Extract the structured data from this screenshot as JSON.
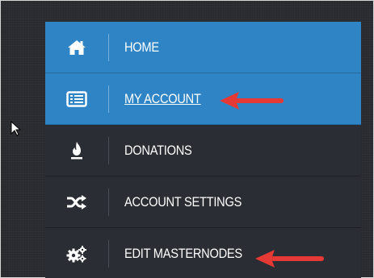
{
  "menu": {
    "items": [
      {
        "label": "HOME",
        "icon": "home-icon"
      },
      {
        "label": "MY ACCOUNT",
        "icon": "account-card-icon"
      },
      {
        "label": "DONATIONS",
        "icon": "flame-icon"
      },
      {
        "label": "ACCOUNT SETTINGS",
        "icon": "shuffle-icon"
      },
      {
        "label": "EDIT MASTERNODES",
        "icon": "gears-icon"
      }
    ]
  },
  "colors": {
    "active_blue": "#2f84c5",
    "dark_item": "#2a2d33",
    "background": "#2b2c31",
    "arrow_red": "#e53935"
  }
}
